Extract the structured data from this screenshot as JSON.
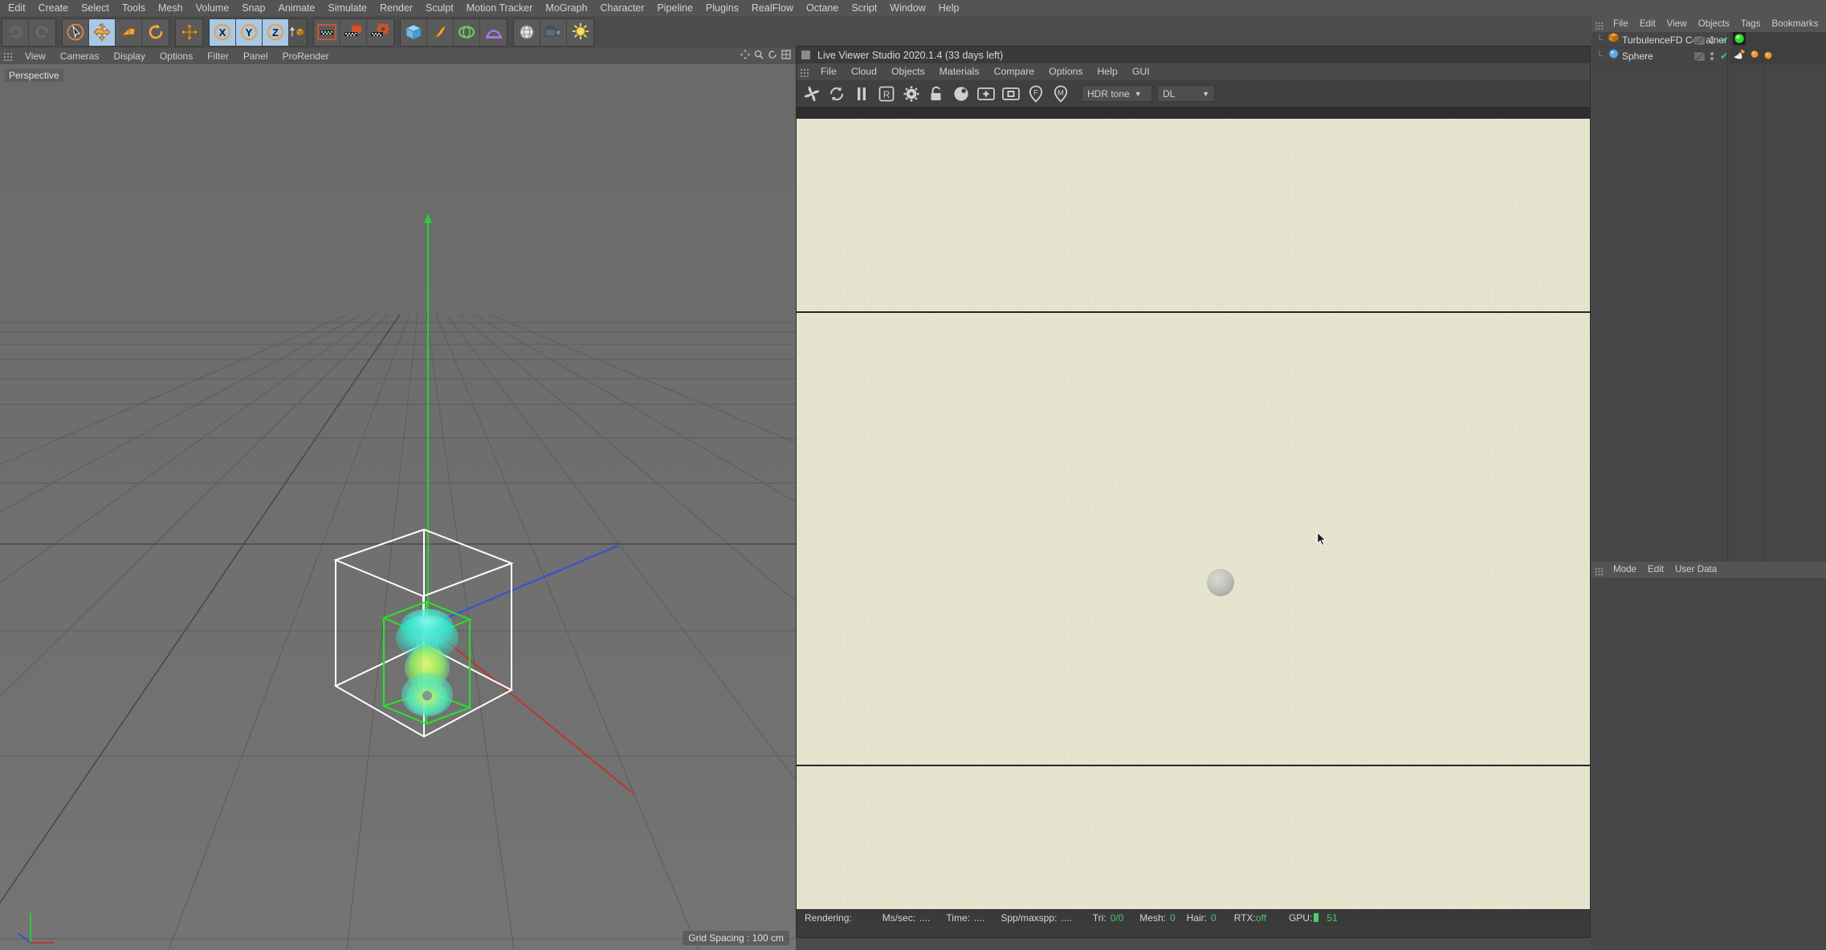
{
  "app": {
    "menubar": [
      {
        "label": "Edit"
      },
      {
        "label": "Create"
      },
      {
        "label": "Select"
      },
      {
        "label": "Tools"
      },
      {
        "label": "Mesh"
      },
      {
        "label": "Volume"
      },
      {
        "label": "Snap"
      },
      {
        "label": "Animate"
      },
      {
        "label": "Simulate"
      },
      {
        "label": "Render"
      },
      {
        "label": "Sculpt"
      },
      {
        "label": "Motion Tracker"
      },
      {
        "label": "MoGraph"
      },
      {
        "label": "Character"
      },
      {
        "label": "Pipeline"
      },
      {
        "label": "Plugins"
      },
      {
        "label": "RealFlow"
      },
      {
        "label": "Octane"
      },
      {
        "label": "Script"
      },
      {
        "label": "Window"
      },
      {
        "label": "Help"
      }
    ],
    "toolbar": [
      {
        "icon": "undo-icon",
        "active": false
      },
      {
        "icon": "redo-icon",
        "active": false
      },
      {
        "icon": "live-selection-icon",
        "active": false
      },
      {
        "icon": "move-tool-icon",
        "active": true
      },
      {
        "icon": "scale-tool-icon",
        "active": false
      },
      {
        "icon": "rotate-tool-icon",
        "active": false
      },
      {
        "icon": "move-axis-icon",
        "active": false
      },
      {
        "icon": "x-axis-lock-icon",
        "active": true
      },
      {
        "icon": "y-axis-lock-icon",
        "active": true
      },
      {
        "icon": "z-axis-lock-icon",
        "active": true
      },
      {
        "icon": "world-object-axis-icon",
        "active": false
      },
      {
        "icon": "render-view-icon",
        "active": false
      },
      {
        "icon": "render-region-icon",
        "active": false
      },
      {
        "icon": "render-settings-icon",
        "active": false
      },
      {
        "icon": "cube-primitive-icon",
        "active": false
      },
      {
        "icon": "spline-pen-icon",
        "active": false
      },
      {
        "icon": "generator-icon",
        "active": false
      },
      {
        "icon": "deformer-icon",
        "active": false
      },
      {
        "icon": "environment-icon",
        "active": false
      },
      {
        "icon": "camera-icon",
        "active": false
      },
      {
        "icon": "light-icon",
        "active": false
      }
    ]
  },
  "viewport": {
    "menubar": [
      {
        "label": "View"
      },
      {
        "label": "Cameras"
      },
      {
        "label": "Display"
      },
      {
        "label": "Options"
      },
      {
        "label": "Filter"
      },
      {
        "label": "Panel"
      },
      {
        "label": "ProRender"
      }
    ],
    "view_label": "Perspective",
    "grid_spacing": "Grid Spacing : 100 cm",
    "scene": {
      "container_color": "#ffffff",
      "emitter_box_color": "#25e525",
      "fluid_colors": [
        "#35e8d8",
        "#49f0a8",
        "#cdf25a",
        "#f2ef7e"
      ],
      "axis_y_color": "#2fc93b",
      "axis_x_color": "#cc3b34",
      "axis_z_color": "#3b4fd0"
    }
  },
  "live_viewer": {
    "title": "Live Viewer Studio 2020.1.4 (33 days left)",
    "menubar": [
      {
        "label": "File"
      },
      {
        "label": "Cloud"
      },
      {
        "label": "Objects"
      },
      {
        "label": "Materials"
      },
      {
        "label": "Compare"
      },
      {
        "label": "Options"
      },
      {
        "label": "Help"
      },
      {
        "label": "GUI"
      }
    ],
    "toolbar_icons": [
      "stop-render-icon",
      "restart-render-icon",
      "pause-render-icon",
      "region-render-icon",
      "render-settings-gear-icon",
      "lock-resolution-icon",
      "sphere-preview-icon",
      "add-object-icon",
      "object-box-icon",
      "focus-picker-icon",
      "material-picker-icon"
    ],
    "tone_select": {
      "value": "HDR tone"
    },
    "device_select": {
      "value": "DL"
    },
    "status": {
      "rendering_label": "Rendering:",
      "ms_label": "Ms/sec:",
      "ms_value": "....",
      "time_label": "Time:",
      "time_value": "....",
      "spp_label": "Spp/maxspp:",
      "spp_value": "....",
      "tri_label": "Tri:",
      "tri_value": "0/0",
      "mesh_label": "Mesh:",
      "mesh_value": "0",
      "hair_label": "Hair:",
      "hair_value": "0",
      "rtx_label": "RTX:",
      "rtx_value": "off",
      "gpu_label": "GPU:",
      "gpu_value": "51"
    }
  },
  "object_manager": {
    "menubar": [
      {
        "label": "File"
      },
      {
        "label": "Edit"
      },
      {
        "label": "View"
      },
      {
        "label": "Objects"
      },
      {
        "label": "Tags"
      },
      {
        "label": "Bookmarks"
      }
    ],
    "rows": [
      {
        "name": "TurbulenceFD Container",
        "icon": "turbulencefd-container-icon",
        "tags": [
          "octane-vdb-tag-icon"
        ]
      },
      {
        "name": "Sphere",
        "icon": "sphere-object-icon",
        "tags": [
          "emitter-tag-icon",
          "octane-object-tag-icon",
          "octane-material-tag-icon"
        ]
      }
    ]
  },
  "attribute_manager": {
    "menubar": [
      {
        "label": "Mode"
      },
      {
        "label": "Edit"
      },
      {
        "label": "User Data"
      }
    ]
  }
}
